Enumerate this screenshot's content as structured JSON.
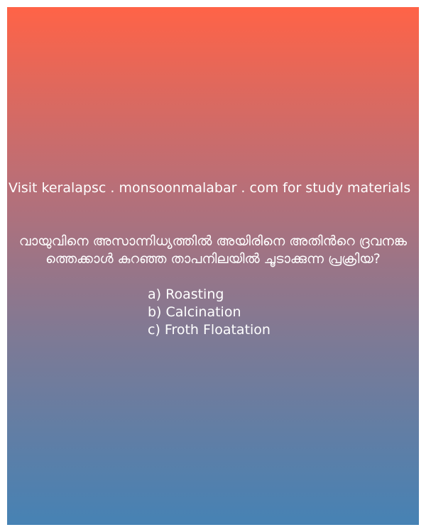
{
  "promo_text": "Visit keralapsc . monsoonmalabar . com for study materials",
  "question": {
    "text": "വായുവിനെ അസാന്നിധ്യത്തിൽ അയിരിനെ അതിൻറെ ദ്രവനങ്കത്തെക്കാൾ കുറഞ്ഞ താപനിലയിൽ ചൂടാക്കുന്ന പ്രക്രിയ?",
    "options": [
      "a) Roasting",
      "b) Calcination",
      "c) Froth Floatation"
    ]
  },
  "colors": {
    "gradient_top": "#ff6347",
    "gradient_bottom": "#4682b4",
    "text": "#ffffff"
  }
}
